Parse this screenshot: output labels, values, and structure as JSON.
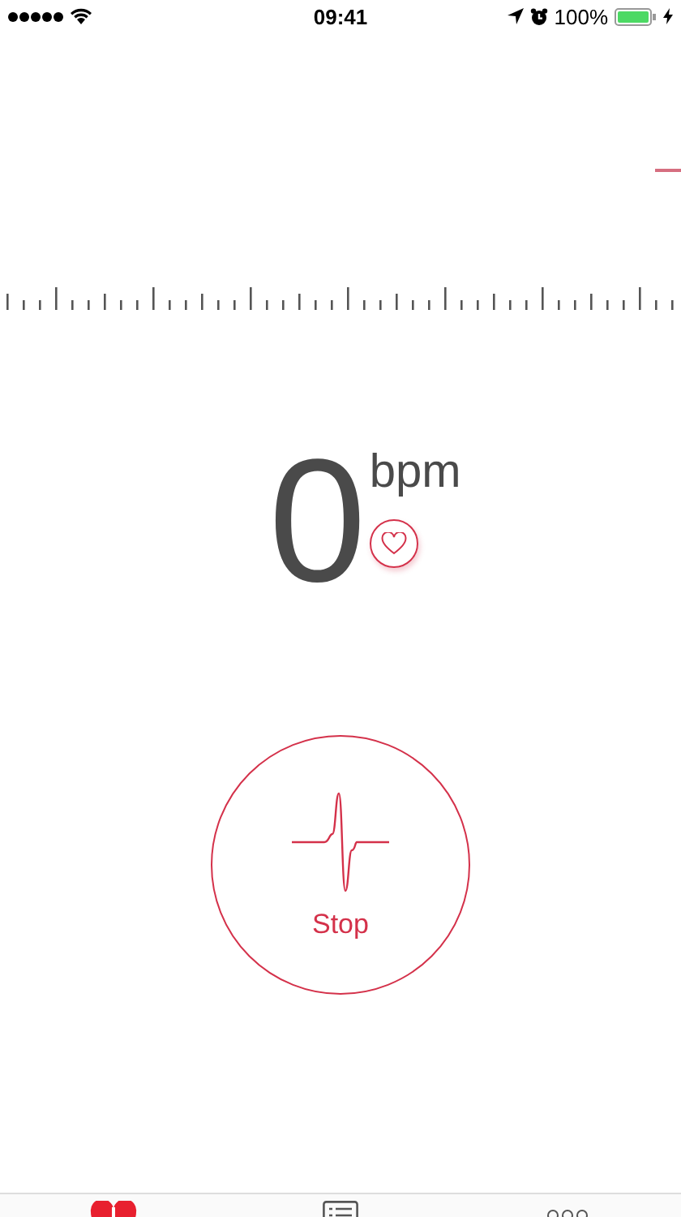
{
  "status_bar": {
    "time": "09:41",
    "battery": "100%"
  },
  "reading": {
    "value": "0",
    "unit": "bpm"
  },
  "stop_button": {
    "label": "Stop"
  },
  "tabs": [
    {
      "kind": "heart",
      "selected": true
    },
    {
      "kind": "list",
      "selected": false
    },
    {
      "kind": "more",
      "selected": false
    }
  ]
}
